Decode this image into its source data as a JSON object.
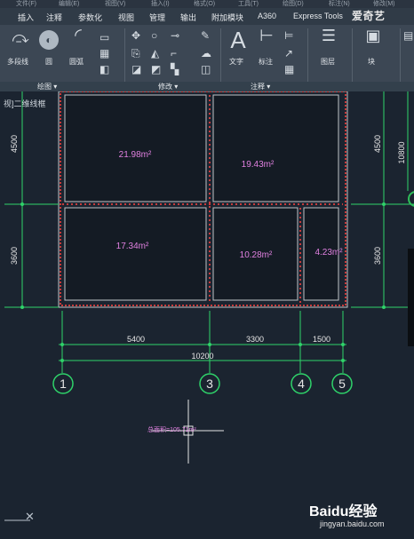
{
  "menu": [
    "文件(F)",
    "编辑(E)",
    "视图(V)",
    "插入(I)",
    "格式(O)",
    "工具(T)",
    "绘图(D)",
    "标注(N)",
    "修改(M)"
  ],
  "tabs": [
    "插入",
    "注释",
    "参数化",
    "视图",
    "管理",
    "输出",
    "附加模块",
    "A360",
    "Express Tools"
  ],
  "watermark_top": "爱奇艺",
  "ribbon": {
    "tool_labels": {
      "polyline": "多段线",
      "circle": "圆",
      "arc": "圆弧",
      "text": "文字",
      "dimension": "标注",
      "layers": "图层",
      "block": "块"
    },
    "panels": {
      "draw": "绘图 ▾",
      "modify": "修改 ▾",
      "annotate": "注释 ▾"
    }
  },
  "view_label": "视]二维线框",
  "drawing": {
    "rooms": [
      {
        "area": "21.98m²"
      },
      {
        "area": "19.43m²"
      },
      {
        "area": "17.34m²"
      },
      {
        "area": "10.28m²"
      },
      {
        "area": "4.23m²"
      }
    ],
    "left_dims": [
      "4500",
      "3600"
    ],
    "right_dims": [
      "4500",
      "3600"
    ],
    "total_height": "10800",
    "bottom_dims": [
      "5400",
      "3300",
      "1500"
    ],
    "total_width": "10200",
    "axis_labels": [
      "1",
      "3",
      "4",
      "5"
    ],
    "cursor_text": "总面积=105.71m²"
  },
  "colors": {
    "wall": "#c0c4c8",
    "hatch": "#c83c3c",
    "dimension": "#2fd36a",
    "area_text": "#e080e0",
    "background": "#1b2430"
  },
  "watermark_bottom": {
    "brand": "Baidu经验",
    "url": "jingyan.baidu.com"
  }
}
